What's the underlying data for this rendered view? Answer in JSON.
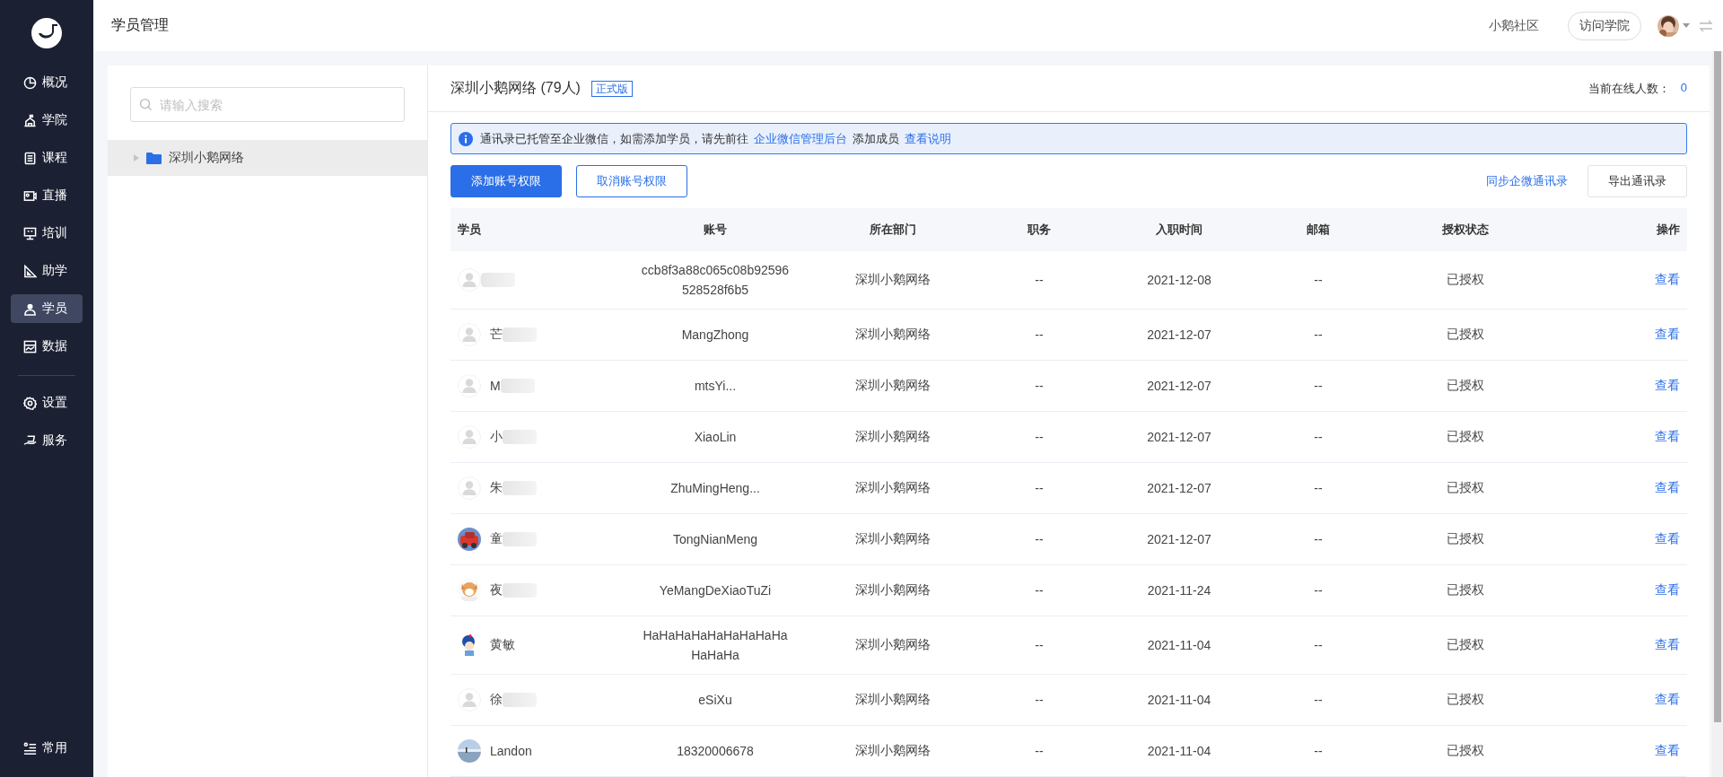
{
  "sidebar": {
    "main_items": [
      {
        "label": "概况",
        "selected": false
      },
      {
        "label": "学院",
        "selected": false
      },
      {
        "label": "课程",
        "selected": false
      },
      {
        "label": "直播",
        "selected": false
      },
      {
        "label": "培训",
        "selected": false
      },
      {
        "label": "助学",
        "selected": false
      },
      {
        "label": "学员",
        "selected": true
      },
      {
        "label": "数据",
        "selected": false
      }
    ],
    "settings_items": [
      {
        "label": "设置",
        "selected": false
      },
      {
        "label": "服务",
        "selected": false
      }
    ],
    "bottom_item": {
      "label": "常用"
    }
  },
  "header": {
    "title": "学员管理",
    "community_link": "小鹅社区",
    "visit_button": "访问学院"
  },
  "org_panel": {
    "search": {
      "placeholder": "请输入搜索"
    },
    "tree": [
      {
        "label": "深圳小鹅网络",
        "selected": true,
        "expanded": false
      }
    ]
  },
  "members": {
    "title": "深圳小鹅网络 (79人)",
    "edition_badge": "正式版",
    "online_label": "当前在线人数：",
    "online_count": "0",
    "notice": {
      "text_before": "通讯录已托管至企业微信，如需添加学员，请先前往",
      "link": "企业微信管理后台",
      "text_middle": "添加成员",
      "help_link": "查看说明"
    },
    "buttons": {
      "add": "添加账号权限",
      "cancel": "取消账号权限",
      "sync": "同步企微通讯录",
      "export": "导出通讯录"
    },
    "table": {
      "columns": [
        "学员",
        "账号",
        "所在部门",
        "职务",
        "入职时间",
        "邮箱",
        "授权状态",
        "操作"
      ],
      "rows": [
        {
          "kind": "default",
          "blurred": true,
          "account": "ccb8f3a88c065c08b92596528528f6b5",
          "department": "深圳小鹅网络",
          "position": "--",
          "join_date": "2021-12-08",
          "email": "--",
          "status": "已授权",
          "action": "查看"
        },
        {
          "kind": "default",
          "name": "芒",
          "blurred": true,
          "account": "MangZhong",
          "department": "深圳小鹅网络",
          "position": "--",
          "join_date": "2021-12-07",
          "email": "--",
          "status": "已授权",
          "action": "查看"
        },
        {
          "kind": "default",
          "name": "M",
          "blurred": true,
          "account": "mtsYi...",
          "department": "深圳小鹅网络",
          "position": "--",
          "join_date": "2021-12-07",
          "email": "--",
          "status": "已授权",
          "action": "查看"
        },
        {
          "kind": "default",
          "name": "小",
          "blurred": true,
          "account": "XiaoLin",
          "department": "深圳小鹅网络",
          "position": "--",
          "join_date": "2021-12-07",
          "email": "--",
          "status": "已授权",
          "action": "查看"
        },
        {
          "kind": "default",
          "name": "朱",
          "blurred": true,
          "account": "ZhuMingHeng...",
          "department": "深圳小鹅网络",
          "position": "--",
          "join_date": "2021-12-07",
          "email": "--",
          "status": "已授权",
          "action": "查看"
        },
        {
          "kind": "picture",
          "name": "童",
          "blurred": true,
          "account": "TongNianMeng",
          "department": "深圳小鹅网络",
          "position": "--",
          "join_date": "2021-12-07",
          "email": "--",
          "status": "已授权",
          "action": "查看"
        },
        {
          "kind": "picture",
          "name": "夜",
          "blurred": true,
          "account": "YeMangDeXiaoTuZi",
          "department": "深圳小鹅网络",
          "position": "--",
          "join_date": "2021-11-24",
          "email": "--",
          "status": "已授权",
          "action": "查看"
        },
        {
          "kind": "picture",
          "name": "黄敏",
          "blurred": false,
          "account": "HaHaHaHaHaHaHaHaHaHaHaHa",
          "department": "深圳小鹅网络",
          "position": "--",
          "join_date": "2021-11-04",
          "email": "--",
          "status": "已授权",
          "action": "查看"
        },
        {
          "kind": "default",
          "name": "徐",
          "blurred": true,
          "account": "eSiXu",
          "department": "深圳小鹅网络",
          "position": "--",
          "join_date": "2021-11-04",
          "email": "--",
          "status": "已授权",
          "action": "查看"
        },
        {
          "kind": "picture",
          "name": "Landon",
          "blurred": false,
          "account": "18320006678",
          "department": "深圳小鹅网络",
          "position": "--",
          "join_date": "2021-11-04",
          "email": "--",
          "status": "已授权",
          "action": "查看"
        }
      ]
    }
  }
}
